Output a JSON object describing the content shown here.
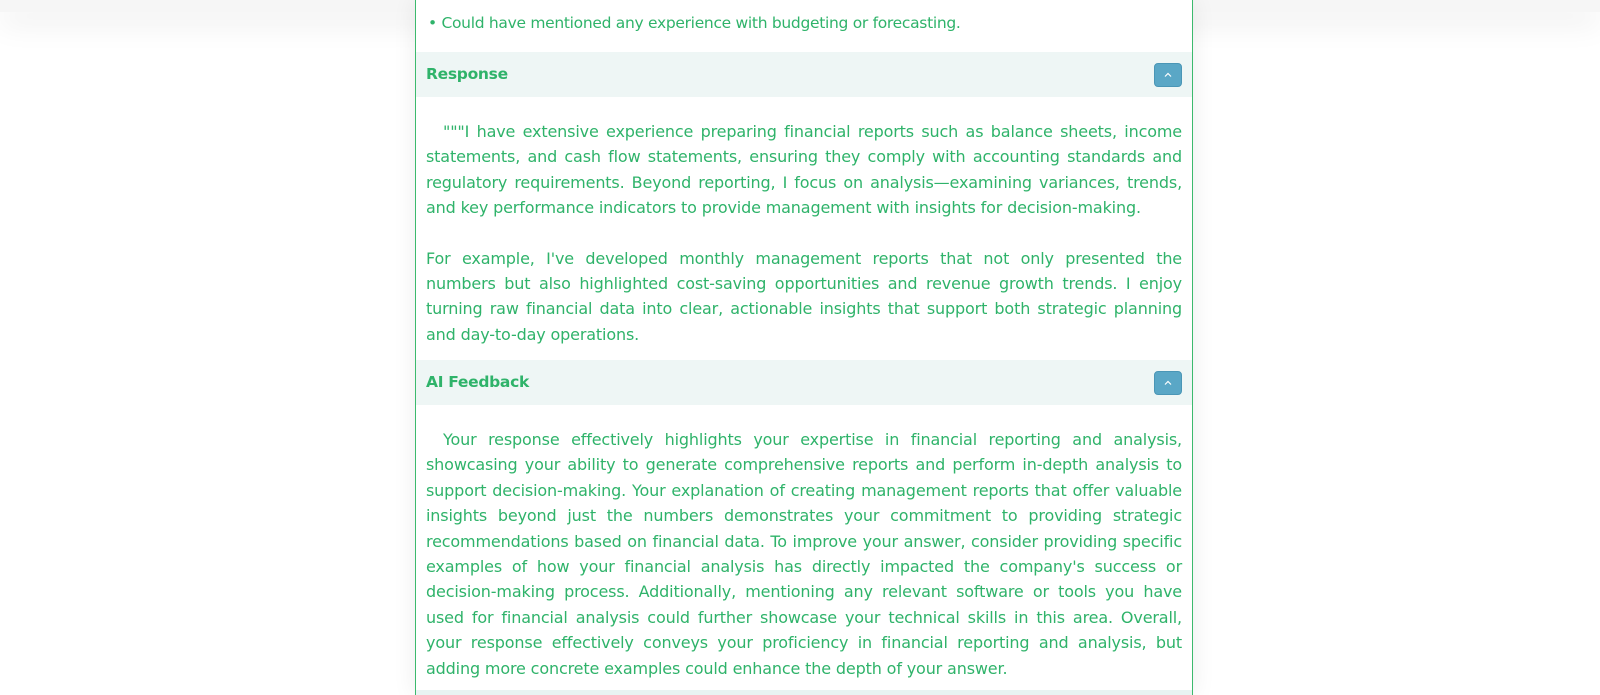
{
  "feedback_tail": {
    "bullet": "• Could have mentioned any experience with budgeting or forecasting."
  },
  "response": {
    "title": "Response",
    "toggle_icon": "chevron-up-icon",
    "paragraph1": "\"\"\"I have extensive experience preparing financial reports such as balance sheets, income statements, and cash flow statements, ensuring they comply with accounting standards and regulatory requirements. Beyond reporting, I focus on analysis—examining variances, trends, and key performance indicators to provide management with insights for decision-making.",
    "paragraph2": "For example, I've developed monthly management reports that not only presented the numbers but also highlighted cost-saving opportunities and revenue growth trends. I enjoy turning raw financial data into clear, actionable insights that support both strategic planning and day-to-day operations."
  },
  "ai_feedback": {
    "title": "AI Feedback",
    "toggle_icon": "chevron-up-icon",
    "paragraph": "Your response effectively highlights your expertise in financial reporting and analysis, showcasing your ability to generate comprehensive reports and perform in-depth analysis to support decision-making. Your explanation of creating management reports that offer valuable insights beyond just the numbers demonstrates your commitment to providing strategic recommendations based on financial data. To improve your answer, consider providing specific examples of how your financial analysis has directly impacted the company's success or decision-making process. Additionally, mentioning any relevant software or tools you have used for financial analysis could further showcase your technical skills in this area. Overall, your response effectively conveys your proficiency in financial reporting and analysis, but adding more concrete examples could enhance the depth of your answer."
  },
  "colors": {
    "accent_green": "#2fb36a",
    "header_bg": "#eef6f5",
    "toggle_blue": "#5aa7c6"
  }
}
